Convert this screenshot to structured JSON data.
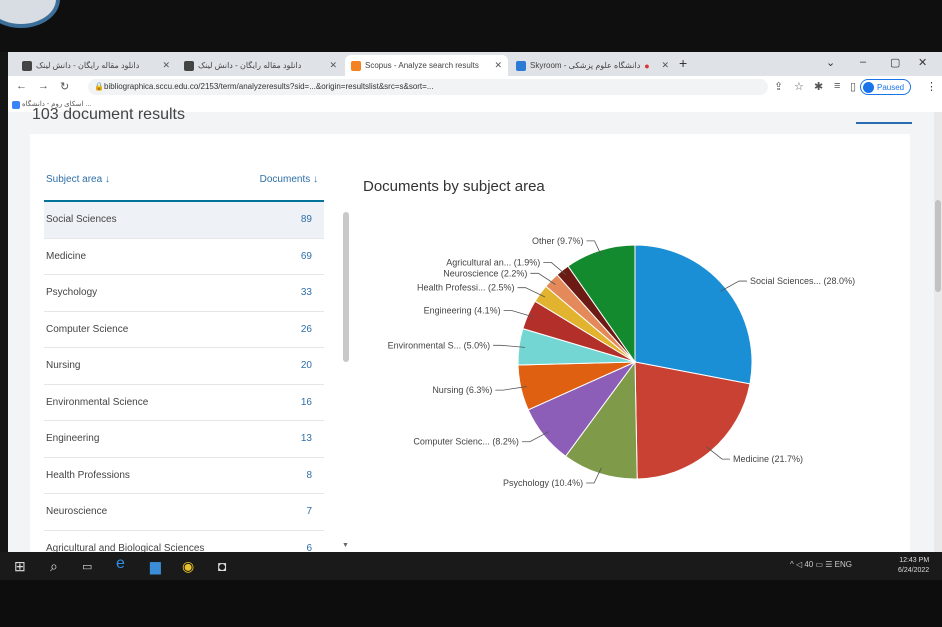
{
  "browser": {
    "tabs": [
      {
        "title": "دانلود مقاله رایگان - دانش لینک",
        "active": false,
        "color": "#444444"
      },
      {
        "title": "دانلود مقاله رایگان - دانش لینک",
        "active": false,
        "color": "#444444"
      },
      {
        "title": "Scopus - Analyze search results",
        "active": true,
        "color": "#f58220"
      },
      {
        "title": "Skyroom - دانشگاه علوم پزشکی",
        "active": false,
        "color": "#2b7bd6"
      }
    ],
    "url": "bibliographica.sccu.edu.co/2153/term/analyzeresults?sid=...&origin=resultslist&src=s&sort=...",
    "profile_label": "Paused",
    "bookmark": "اسکای روم - دانشگاه ..."
  },
  "page": {
    "heading": "103 document results"
  },
  "table": {
    "col_subject": "Subject area ↓",
    "col_documents": "Documents ↓",
    "rows": [
      {
        "name": "Social Sciences",
        "value": "89"
      },
      {
        "name": "Medicine",
        "value": "69"
      },
      {
        "name": "Psychology",
        "value": "33"
      },
      {
        "name": "Computer Science",
        "value": "26"
      },
      {
        "name": "Nursing",
        "value": "20"
      },
      {
        "name": "Environmental Science",
        "value": "16"
      },
      {
        "name": "Engineering",
        "value": "13"
      },
      {
        "name": "Health Professions",
        "value": "8"
      },
      {
        "name": "Neuroscience",
        "value": "7"
      },
      {
        "name": "Agricultural and Biological Sciences",
        "value": "6"
      }
    ]
  },
  "chart_data": {
    "type": "pie",
    "title": "Documents by subject area",
    "slices": [
      {
        "label": "Social Sciences... (28.0%)",
        "value": 28.0,
        "color": "#1a8fd6"
      },
      {
        "label": "Medicine (21.7%)",
        "value": 21.7,
        "color": "#c84132"
      },
      {
        "label": "Psychology (10.4%)",
        "value": 10.4,
        "color": "#7f9a48"
      },
      {
        "label": "Computer Scienc... (8.2%)",
        "value": 8.2,
        "color": "#8c5eb8"
      },
      {
        "label": "Nursing (6.3%)",
        "value": 6.3,
        "color": "#e06012"
      },
      {
        "label": "Environmental S... (5.0%)",
        "value": 5.0,
        "color": "#74d6d2"
      },
      {
        "label": "Engineering (4.1%)",
        "value": 4.1,
        "color": "#b32f2a"
      },
      {
        "label": "Health Professi... (2.5%)",
        "value": 2.5,
        "color": "#e2b32e"
      },
      {
        "label": "Neuroscience (2.2%)",
        "value": 2.2,
        "color": "#e48a5a"
      },
      {
        "label": "Agricultural an... (1.9%)",
        "value": 1.9,
        "color": "#6b1a14"
      },
      {
        "label": "Other (9.7%)",
        "value": 9.7,
        "color": "#148a2e"
      }
    ]
  },
  "taskbar": {
    "tray": "^ ◁ 40 ▭ ☰ ENG",
    "time": "12:43 PM",
    "date": "6/24/2022"
  }
}
